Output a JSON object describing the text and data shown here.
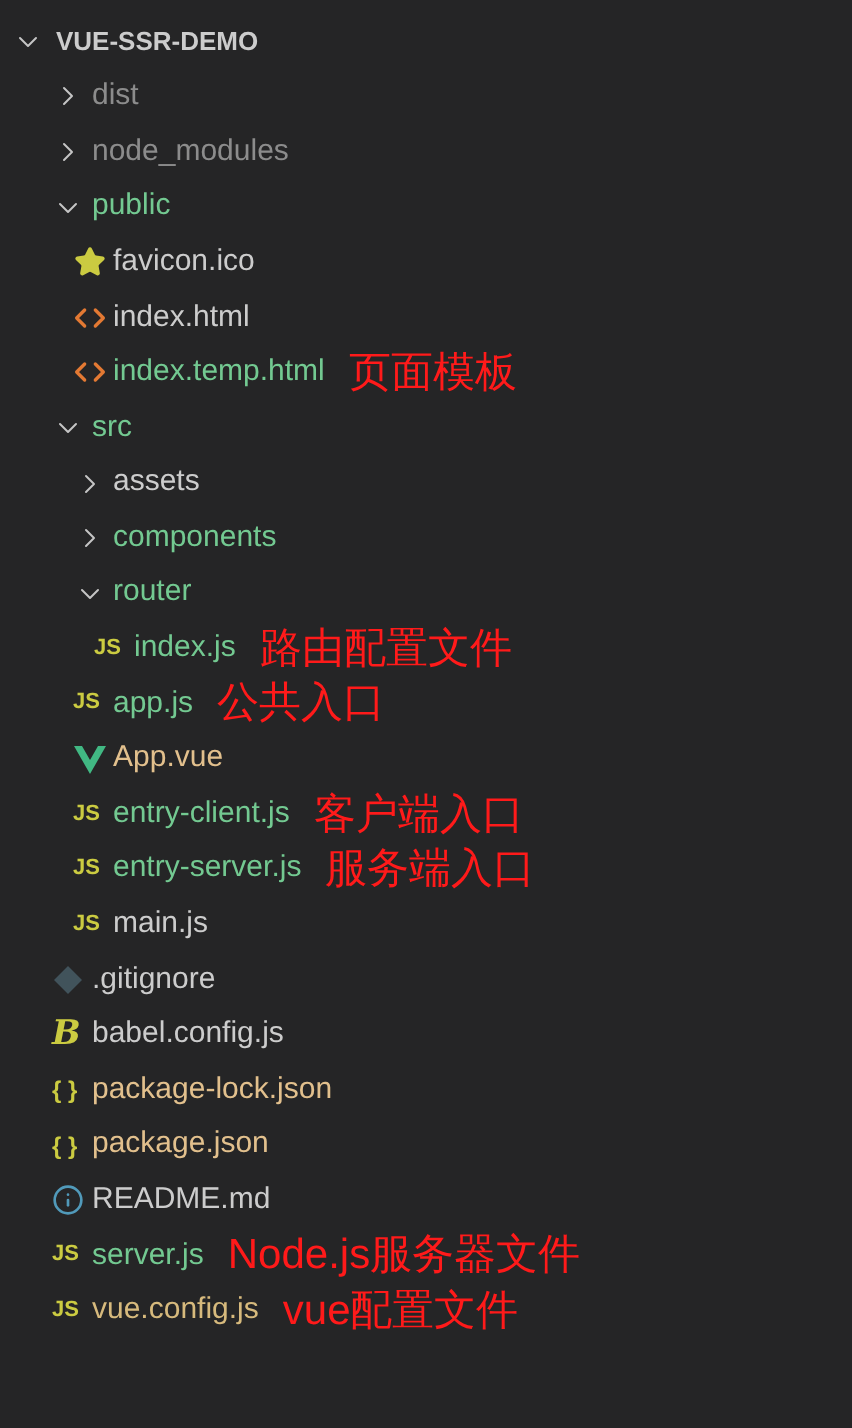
{
  "explorer": {
    "title": "VUE-SSR-DEMO",
    "expanded": true,
    "items": [
      {
        "kind": "folder",
        "name": "dist",
        "expanded": false,
        "color": "#8c8c8c"
      },
      {
        "kind": "folder",
        "name": "node_modules",
        "expanded": false,
        "color": "#8c8c8c"
      },
      {
        "kind": "folder",
        "name": "public",
        "expanded": true,
        "color": "#73c991",
        "children": [
          {
            "kind": "star",
            "name": "favicon.ico",
            "color": "#cccccc"
          },
          {
            "kind": "html",
            "name": "index.html",
            "color": "#cccccc"
          },
          {
            "kind": "html",
            "name": "index.temp.html",
            "color": "#73c991",
            "note": "页面模板"
          }
        ]
      },
      {
        "kind": "folder",
        "name": "src",
        "expanded": true,
        "color": "#73c991",
        "children": [
          {
            "kind": "folder",
            "name": "assets",
            "expanded": false,
            "color": "#cccccc"
          },
          {
            "kind": "folder",
            "name": "components",
            "expanded": false,
            "color": "#73c991"
          },
          {
            "kind": "folder",
            "name": "router",
            "expanded": true,
            "color": "#73c991",
            "children": [
              {
                "kind": "js",
                "badge": "JS",
                "name": "index.js",
                "color": "#73c991",
                "note": "路由配置文件"
              }
            ]
          },
          {
            "kind": "js",
            "badge": "JS",
            "name": "app.js",
            "color": "#73c991",
            "note": "公共入口"
          },
          {
            "kind": "vue",
            "name": "App.vue",
            "color": "#e2c08d"
          },
          {
            "kind": "js",
            "badge": "JS",
            "name": "entry-client.js",
            "color": "#73c991",
            "note": "客户端入口"
          },
          {
            "kind": "js",
            "badge": "JS",
            "name": "entry-server.js",
            "color": "#73c991",
            "note": "服务端入口"
          },
          {
            "kind": "js",
            "badge": "JS",
            "name": "main.js",
            "color": "#cccccc"
          }
        ]
      },
      {
        "kind": "git",
        "name": ".gitignore",
        "color": "#cccccc"
      },
      {
        "kind": "babel",
        "badge": "B",
        "name": "babel.config.js",
        "color": "#cccccc"
      },
      {
        "kind": "json",
        "badge": "{ }",
        "name": "package-lock.json",
        "color": "#e2c08d"
      },
      {
        "kind": "json",
        "badge": "{ }",
        "name": "package.json",
        "color": "#e2c08d"
      },
      {
        "kind": "info",
        "name": "README.md",
        "color": "#cccccc"
      },
      {
        "kind": "js",
        "badge": "JS",
        "name": "server.js",
        "color": "#73c991",
        "note": "Node.js服务器文件"
      },
      {
        "kind": "js",
        "badge": "JS",
        "name": "vue.config.js",
        "color": "#d7ba7d",
        "note": "vue配置文件"
      }
    ]
  }
}
